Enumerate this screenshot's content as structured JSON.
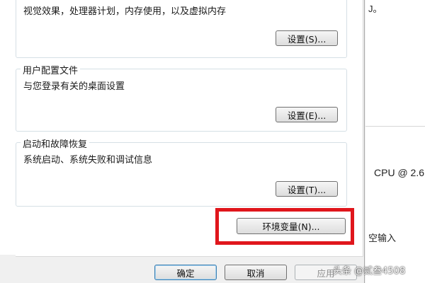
{
  "performance": {
    "description": "视觉效果，处理器计划，内存使用，以及虚拟内存",
    "settings_label": "设置(S)..."
  },
  "user_profiles": {
    "title": "用户配置文件",
    "description": "与您登录有关的桌面设置",
    "settings_label": "设置(E)..."
  },
  "startup_recovery": {
    "title": "启动和故障恢复",
    "description": "系统启动、系统失败和调试信息",
    "settings_label": "设置(T)..."
  },
  "env_vars_label": "环境变量(N)...",
  "footer": {
    "ok_label": "确定",
    "cancel_label": "取消",
    "apply_label": "应用"
  },
  "background_window": {
    "top_fragment": "J。",
    "cpu_fragment": "CPU @ 2.6",
    "input_fragment": "空输入"
  },
  "watermark": "头条 @贰叁4508",
  "colors": {
    "highlight": "#e0161c",
    "panel_bg": "#ffffff",
    "dialog_bg": "#f0f0f0"
  }
}
